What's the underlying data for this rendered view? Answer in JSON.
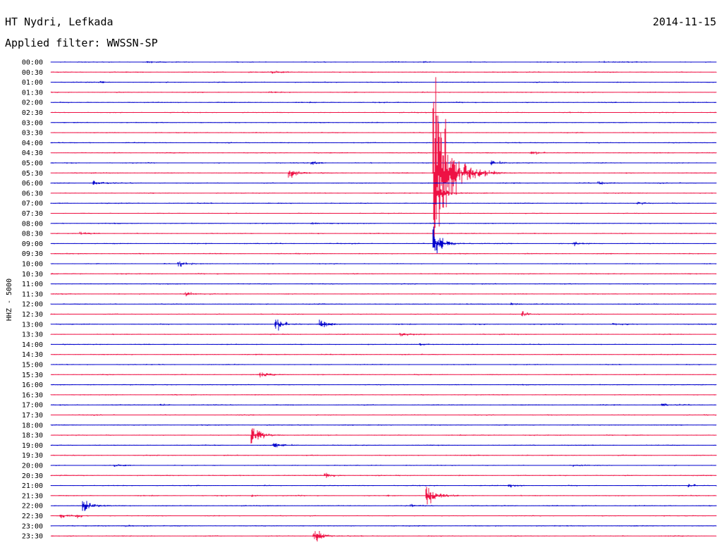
{
  "header": {
    "station": "HT Nydri, Lefkada",
    "date": "2014-11-15",
    "filter": "Applied filter: WWSSN-SP"
  },
  "chart_data": {
    "type": "line",
    "title": "HT Nydri, Lefkada",
    "subtitle": "Applied filter: WWSSN-SP",
    "date": "2014-11-15",
    "ylabel": "HHZ - 5000",
    "rows": [
      "00:00",
      "00:30",
      "01:00",
      "01:30",
      "02:00",
      "02:30",
      "03:00",
      "03:30",
      "04:00",
      "04:30",
      "05:00",
      "05:30",
      "06:00",
      "06:30",
      "07:00",
      "07:30",
      "08:00",
      "08:30",
      "09:00",
      "09:30",
      "10:00",
      "10:30",
      "11:00",
      "11:30",
      "12:00",
      "12:30",
      "13:00",
      "13:30",
      "14:00",
      "14:30",
      "15:00",
      "15:30",
      "16:00",
      "16:30",
      "17:00",
      "17:30",
      "18:00",
      "18:30",
      "19:00",
      "19:30",
      "20:00",
      "20:30",
      "21:00",
      "21:30",
      "22:00",
      "22:30",
      "23:00",
      "23:30"
    ],
    "row_minutes": 30,
    "colors": [
      "#0000cc",
      "#ee1144"
    ],
    "events": [
      {
        "row": 0,
        "minute": 4.3,
        "amp": 0.2
      },
      {
        "row": 0,
        "minute": 16.8,
        "amp": 0.2
      },
      {
        "row": 0,
        "minute": 24.7,
        "amp": 0.25
      },
      {
        "row": 1,
        "minute": 8.9,
        "amp": 0.15
      },
      {
        "row": 1,
        "minute": 9.9,
        "amp": 0.35
      },
      {
        "row": 2,
        "minute": 2.2,
        "amp": 0.15
      },
      {
        "row": 3,
        "minute": 9.8,
        "amp": 0.2
      },
      {
        "row": 3,
        "minute": 22.0,
        "amp": 0.2
      },
      {
        "row": 5,
        "minute": 14.5,
        "amp": 0.1
      },
      {
        "row": 9,
        "minute": 21.6,
        "amp": 0.5
      },
      {
        "row": 10,
        "minute": 11.7,
        "amp": 0.6
      },
      {
        "row": 10,
        "minute": 19.8,
        "amp": 0.7
      },
      {
        "row": 11,
        "minute": 10.7,
        "amp": 1.5
      },
      {
        "row": 12,
        "minute": 1.9,
        "amp": 0.6
      },
      {
        "row": 12,
        "minute": 24.6,
        "amp": 0.4
      },
      {
        "row": 13,
        "minute": 17.3,
        "amp": 2.4
      },
      {
        "row": 14,
        "minute": 26.4,
        "amp": 0.3
      },
      {
        "row": 16,
        "minute": 11.7,
        "amp": 0.25
      },
      {
        "row": 17,
        "minute": 1.3,
        "amp": 0.3
      },
      {
        "row": 18,
        "minute": 17.2,
        "amp": 5.0
      },
      {
        "row": 18,
        "minute": 23.5,
        "amp": 0.4
      },
      {
        "row": 20,
        "minute": 5.7,
        "amp": 0.9
      },
      {
        "row": 23,
        "minute": 6.0,
        "amp": 0.7
      },
      {
        "row": 24,
        "minute": 20.7,
        "amp": 0.3
      },
      {
        "row": 25,
        "minute": 21.2,
        "amp": 0.5
      },
      {
        "row": 26,
        "minute": 10.1,
        "amp": 1.6
      },
      {
        "row": 26,
        "minute": 12.1,
        "amp": 1.0
      },
      {
        "row": 26,
        "minute": 25.3,
        "amp": 0.35
      },
      {
        "row": 27,
        "minute": 15.7,
        "amp": 0.6
      },
      {
        "row": 28,
        "minute": 16.6,
        "amp": 0.2
      },
      {
        "row": 31,
        "minute": 9.4,
        "amp": 0.5
      },
      {
        "row": 34,
        "minute": 4.9,
        "amp": 0.2
      },
      {
        "row": 34,
        "minute": 27.5,
        "amp": 0.3
      },
      {
        "row": 37,
        "minute": 9.0,
        "amp": 3.0
      },
      {
        "row": 38,
        "minute": 10.0,
        "amp": 0.8
      },
      {
        "row": 40,
        "minute": 2.8,
        "amp": 0.3
      },
      {
        "row": 40,
        "minute": 23.5,
        "amp": 0.2
      },
      {
        "row": 41,
        "minute": 12.3,
        "amp": 0.8
      },
      {
        "row": 42,
        "minute": 20.6,
        "amp": 0.5
      },
      {
        "row": 42,
        "minute": 28.7,
        "amp": 0.5
      },
      {
        "row": 43,
        "minute": 9.0,
        "amp": 0.2
      },
      {
        "row": 43,
        "minute": 15.1,
        "amp": 0.2
      },
      {
        "row": 43,
        "minute": 16.9,
        "amp": 2.5
      },
      {
        "row": 44,
        "minute": 1.4,
        "amp": 1.5
      },
      {
        "row": 44,
        "minute": 16.2,
        "amp": 0.2
      },
      {
        "row": 45,
        "minute": 0.4,
        "amp": 0.6
      },
      {
        "row": 45,
        "minute": 1.1,
        "amp": 0.4
      },
      {
        "row": 46,
        "minute": 3.3,
        "amp": 0.2
      },
      {
        "row": 47,
        "minute": 11.8,
        "amp": 1.8
      }
    ],
    "teleseism": {
      "row": 11,
      "minute": 17.3,
      "amp": 9.0,
      "coda_rows": 19
    }
  }
}
